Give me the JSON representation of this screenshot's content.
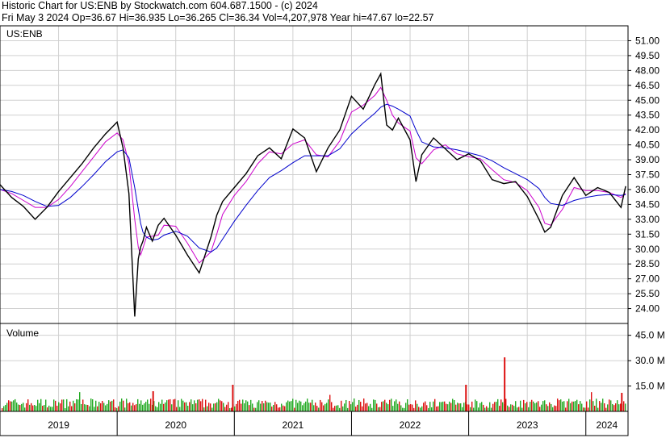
{
  "header": {
    "line1": "Historic Chart for US:ENB by Stockwatch.com 604.687.1500 - (c) 2024",
    "line2": "Fri May  3 2024   Op=36.67   Hi=36.935   Lo=36.265   Cl=36.34   Vol=4,207,978   Year hi=47.67   lo=22.57"
  },
  "price_panel": {
    "label": "US:ENB"
  },
  "volume_panel": {
    "label": "Volume"
  },
  "colors": {
    "price": "#000000",
    "ma_short": "#cc00cc",
    "ma_long": "#0000cc",
    "vol_up": "#22aa22",
    "vol_down": "#dd1111",
    "grid": "#d0d0d0"
  },
  "chart_data": [
    {
      "type": "line",
      "title": "US:ENB",
      "ylim": [
        22.5,
        52.5
      ],
      "yticks": [
        "51.00",
        "49.50",
        "48.00",
        "46.50",
        "45.00",
        "43.50",
        "42.00",
        "40.50",
        "39.00",
        "37.50",
        "36.00",
        "34.50",
        "33.00",
        "31.50",
        "30.00",
        "28.50",
        "27.00",
        "25.50",
        "24.00"
      ],
      "x_labels": [
        "2019",
        "2020",
        "2021",
        "2022",
        "2023",
        "2024"
      ],
      "x": [
        2019.0,
        2019.1,
        2019.2,
        2019.3,
        2019.4,
        2019.5,
        2019.6,
        2019.7,
        2019.8,
        2019.9,
        2020.0,
        2020.05,
        2020.1,
        2020.15,
        2020.18,
        2020.2,
        2020.22,
        2020.25,
        2020.3,
        2020.35,
        2020.4,
        2020.5,
        2020.6,
        2020.7,
        2020.8,
        2020.85,
        2020.9,
        2021.0,
        2021.1,
        2021.2,
        2021.3,
        2021.4,
        2021.5,
        2021.6,
        2021.7,
        2021.8,
        2021.9,
        2022.0,
        2022.1,
        2022.2,
        2022.25,
        2022.3,
        2022.35,
        2022.4,
        2022.5,
        2022.55,
        2022.6,
        2022.7,
        2022.8,
        2022.9,
        2023.0,
        2023.1,
        2023.2,
        2023.3,
        2023.4,
        2023.5,
        2023.6,
        2023.65,
        2023.7,
        2023.8,
        2023.9,
        2024.0,
        2024.1,
        2024.2,
        2024.3,
        2024.34
      ],
      "series": [
        {
          "values": [
            36.5,
            35.2,
            34.3,
            33.0,
            34.2,
            35.8,
            37.2,
            38.6,
            40.2,
            41.6,
            42.8,
            40.2,
            35.6,
            23.2,
            29.0,
            30.2,
            30.8,
            32.2,
            30.8,
            32.4,
            33.1,
            31.4,
            29.4,
            27.6,
            31.2,
            33.4,
            34.8,
            36.2,
            37.6,
            39.4,
            40.2,
            39.1,
            42.1,
            41.2,
            37.8,
            40.2,
            42.0,
            45.4,
            44.1,
            46.6,
            47.67,
            42.5,
            42.0,
            43.2,
            41.0,
            36.8,
            39.5,
            41.2,
            40.1,
            39.0,
            39.6,
            38.9,
            37.0,
            36.6,
            36.8,
            35.3,
            33.0,
            31.7,
            32.2,
            35.4,
            37.2,
            35.4,
            36.2,
            35.7,
            34.2,
            36.34
          ]
        },
        {
          "name": "",
          "values": [
            36.0,
            35.6,
            34.9,
            34.2,
            34.2,
            35.0,
            36.3,
            37.8,
            39.3,
            40.8,
            41.7,
            41.0,
            38.6,
            33.0,
            30.2,
            29.4,
            30.1,
            31.2,
            31.3,
            31.4,
            32.4,
            32.3,
            30.6,
            28.6,
            29.7,
            31.5,
            33.5,
            35.4,
            36.8,
            38.6,
            39.8,
            39.6,
            40.6,
            41.0,
            39.5,
            39.3,
            40.9,
            43.8,
            44.5,
            45.5,
            46.3,
            45.0,
            43.5,
            42.7,
            41.9,
            39.2,
            38.6,
            40.0,
            40.5,
            39.6,
            39.3,
            39.1,
            38.0,
            37.0,
            36.7,
            35.9,
            34.2,
            32.6,
            32.4,
            34.0,
            36.2,
            35.9,
            35.9,
            35.7,
            35.2,
            35.6
          ]
        },
        {
          "name": "",
          "values": [
            36.0,
            35.8,
            35.4,
            34.8,
            34.3,
            34.4,
            35.2,
            36.3,
            37.5,
            38.8,
            39.8,
            40.0,
            39.2,
            36.2,
            34.0,
            32.6,
            31.7,
            31.2,
            30.9,
            31.0,
            31.4,
            31.8,
            31.3,
            30.1,
            29.7,
            30.1,
            31.0,
            32.8,
            34.4,
            35.9,
            37.2,
            37.9,
            38.7,
            39.4,
            39.4,
            39.4,
            40.1,
            41.6,
            42.7,
            43.7,
            44.3,
            44.6,
            44.4,
            44.1,
            43.4,
            42.0,
            40.8,
            40.3,
            40.2,
            40.0,
            39.7,
            39.4,
            38.9,
            38.2,
            37.6,
            37.0,
            36.1,
            35.2,
            34.6,
            34.4,
            34.9,
            35.2,
            35.4,
            35.5,
            35.4,
            35.5
          ]
        }
      ]
    },
    {
      "type": "bar",
      "title": "Volume",
      "ylim": [
        0,
        52
      ],
      "yticks": [
        "45.0 M",
        "30.0 M",
        "15.0 M"
      ],
      "x_labels": [
        "2019",
        "2020",
        "2021",
        "2022",
        "2023",
        "2024"
      ]
    }
  ]
}
